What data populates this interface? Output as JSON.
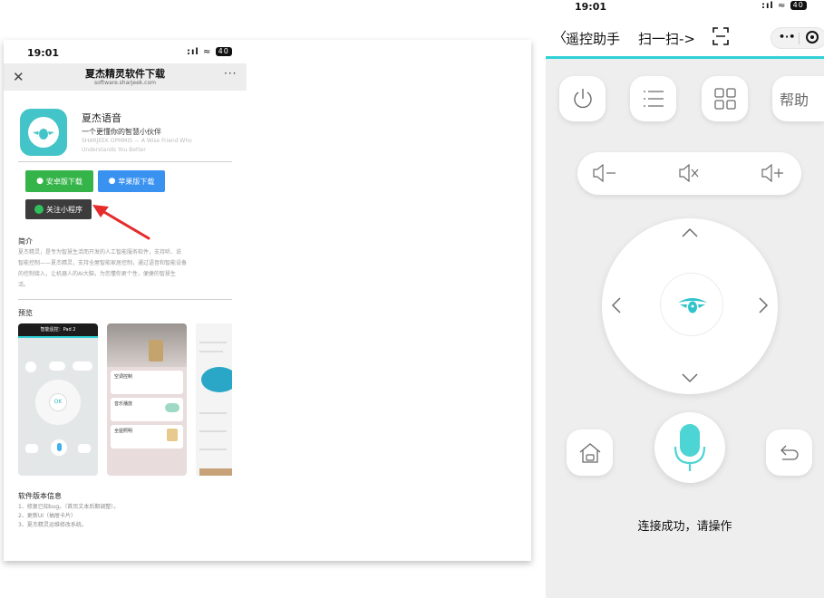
{
  "left": {
    "status_time": "19:01",
    "status_signal": ":ıl",
    "status_wifi": "≈",
    "status_battery": "40",
    "header": {
      "close_label": "✕",
      "title": "夏杰精灵软件下载",
      "url": "software.sharjeek.com",
      "more_label": "···"
    },
    "app": {
      "name": "夏杰语音",
      "slogan": "一个更懂你的智慧小伙伴",
      "en_line1": "SHARJEEK OPMMIS — A Wise Friend Who",
      "en_line2": "Understands You Better"
    },
    "buttons": {
      "android": "安卓版下载",
      "apple": "苹果版下载",
      "mini_program": "关注小程序"
    },
    "intro": {
      "heading": "简介",
      "lines": [
        "夏杰精灵，是专为智慧生活而开发的人工智能服务软件，支持听、说",
        "智能控制——夏杰精灵，支持全屋智能家居控制，通过语音和智能设备",
        "的控制接入，让机器人的AI大脑，为您懂你更个性，便捷的智慧生",
        "活。"
      ]
    },
    "preview": {
      "heading": "预览",
      "shot1_title": "智能遥控：Pad 2",
      "shot1_ok": "OK",
      "shot2_items": [
        "空调控制",
        "音乐播放",
        "全屋照明"
      ]
    },
    "version": {
      "heading": "软件版本信息",
      "lines": [
        "1、修复已知bug。（首页文本后期调整）。",
        "2、更新UI（抽屉卡片）",
        "3、夏杰精灵运维修改系统。"
      ]
    }
  },
  "right": {
    "status_time": "19:01",
    "status_signal": ":ıl",
    "status_wifi": "≈",
    "status_battery": "40",
    "nav": {
      "back_label": "〈",
      "title": "遥控助手",
      "scan_label": "扫一扫->"
    },
    "help_label": "帮助",
    "status_message": "连接成功，请操作",
    "colors": {
      "accent": "#2fd1d6",
      "mic": "#4dd4d4",
      "icon_gray": "#6b6b6b"
    },
    "icons": [
      "power-icon",
      "menu-icon",
      "grid-icon",
      "volume-down-icon",
      "mute-icon",
      "volume-up-icon",
      "arrow-up-icon",
      "arrow-down-icon",
      "arrow-left-icon",
      "arrow-right-icon",
      "home-icon",
      "microphone-icon",
      "return-icon"
    ]
  }
}
